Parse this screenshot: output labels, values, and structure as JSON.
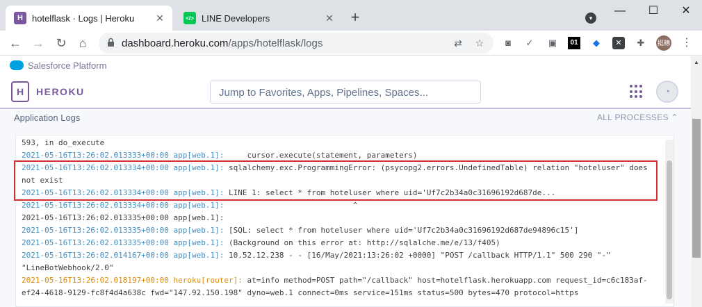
{
  "browser": {
    "tabs": [
      {
        "title": "hotelflask · Logs | Heroku",
        "favicon": "heroku-favicon",
        "active": true
      },
      {
        "title": "LINE Developers",
        "favicon": "line-favicon",
        "active": false
      }
    ],
    "close_glyph": "✕",
    "newtab_glyph": "+",
    "window": {
      "minimize": "—",
      "maximize": "☐",
      "close": "✕"
    },
    "url_host": "dashboard.heroku.com",
    "url_path": "/apps/hotelflask/logs",
    "avatar_text": "挺穗"
  },
  "salesforce": {
    "label": "Salesforce Platform"
  },
  "heroku": {
    "brand": "HEROKU",
    "logo_letter": "H",
    "search_placeholder": "Jump to Favorites, Apps, Pipelines, Spaces..."
  },
  "logs": {
    "title": "Application Logs",
    "filter": "ALL PROCESSES ⌃",
    "lines": [
      {
        "ts": "",
        "src": "",
        "msg": "593, in do_execute"
      },
      {
        "ts": "2021-05-16T13:26:02.013333+00:00",
        "src": "app[web.1]:",
        "msg": "     cursor.execute(statement, parameters)"
      },
      {
        "ts": "2021-05-16T13:26:02.013334+00:00",
        "src": "app[web.1]:",
        "msg": " sqlalchemy.exc.ProgrammingError: (psycopg2.errors.UndefinedTable) relation \"hoteluser\" does"
      },
      {
        "ts": "",
        "src": "",
        "msg": "not exist"
      },
      {
        "ts": "2021-05-16T13:26:02.013334+00:00",
        "src": "app[web.1]:",
        "msg": " LINE 1: select * from hoteluser where uid='Uf7c2b34a0c31696192d687de..."
      },
      {
        "ts": "2021-05-16T13:26:02.013334+00:00",
        "src": "app[web.1]:",
        "msg": "                            ^"
      },
      {
        "ts": "",
        "src": "",
        "msg": "2021-05-16T13:26:02.013335+00:00 app[web.1]:"
      },
      {
        "ts": "2021-05-16T13:26:02.013335+00:00",
        "src": "app[web.1]:",
        "msg": " [SQL: select * from hoteluser where uid='Uf7c2b34a0c31696192d687de94896c15']"
      },
      {
        "ts": "2021-05-16T13:26:02.013335+00:00",
        "src": "app[web.1]:",
        "msg": " (Background on this error at: http://sqlalche.me/e/13/f405)"
      },
      {
        "ts": "2021-05-16T13:26:02.014167+00:00",
        "src": "app[web.1]:",
        "msg": " 10.52.12.238 - - [16/May/2021:13:26:02 +0000] \"POST /callback HTTP/1.1\" 500 290 \"-\""
      },
      {
        "ts": "",
        "src": "",
        "msg": "\"LineBotWebhook/2.0\""
      },
      {
        "ts": "2021-05-16T13:26:02.018197+00:00",
        "src": "heroku[router]:",
        "msg": " at=info method=POST path=\"/callback\" host=hotelflask.herokuapp.com request_id=c6c183af-",
        "router": true
      },
      {
        "ts": "",
        "src": "",
        "msg": "ef24-4618-9129-fc8f4d4a638c fwd=\"147.92.150.198\" dyno=web.1 connect=0ms service=151ms status=500 bytes=470 protocol=https"
      }
    ]
  }
}
